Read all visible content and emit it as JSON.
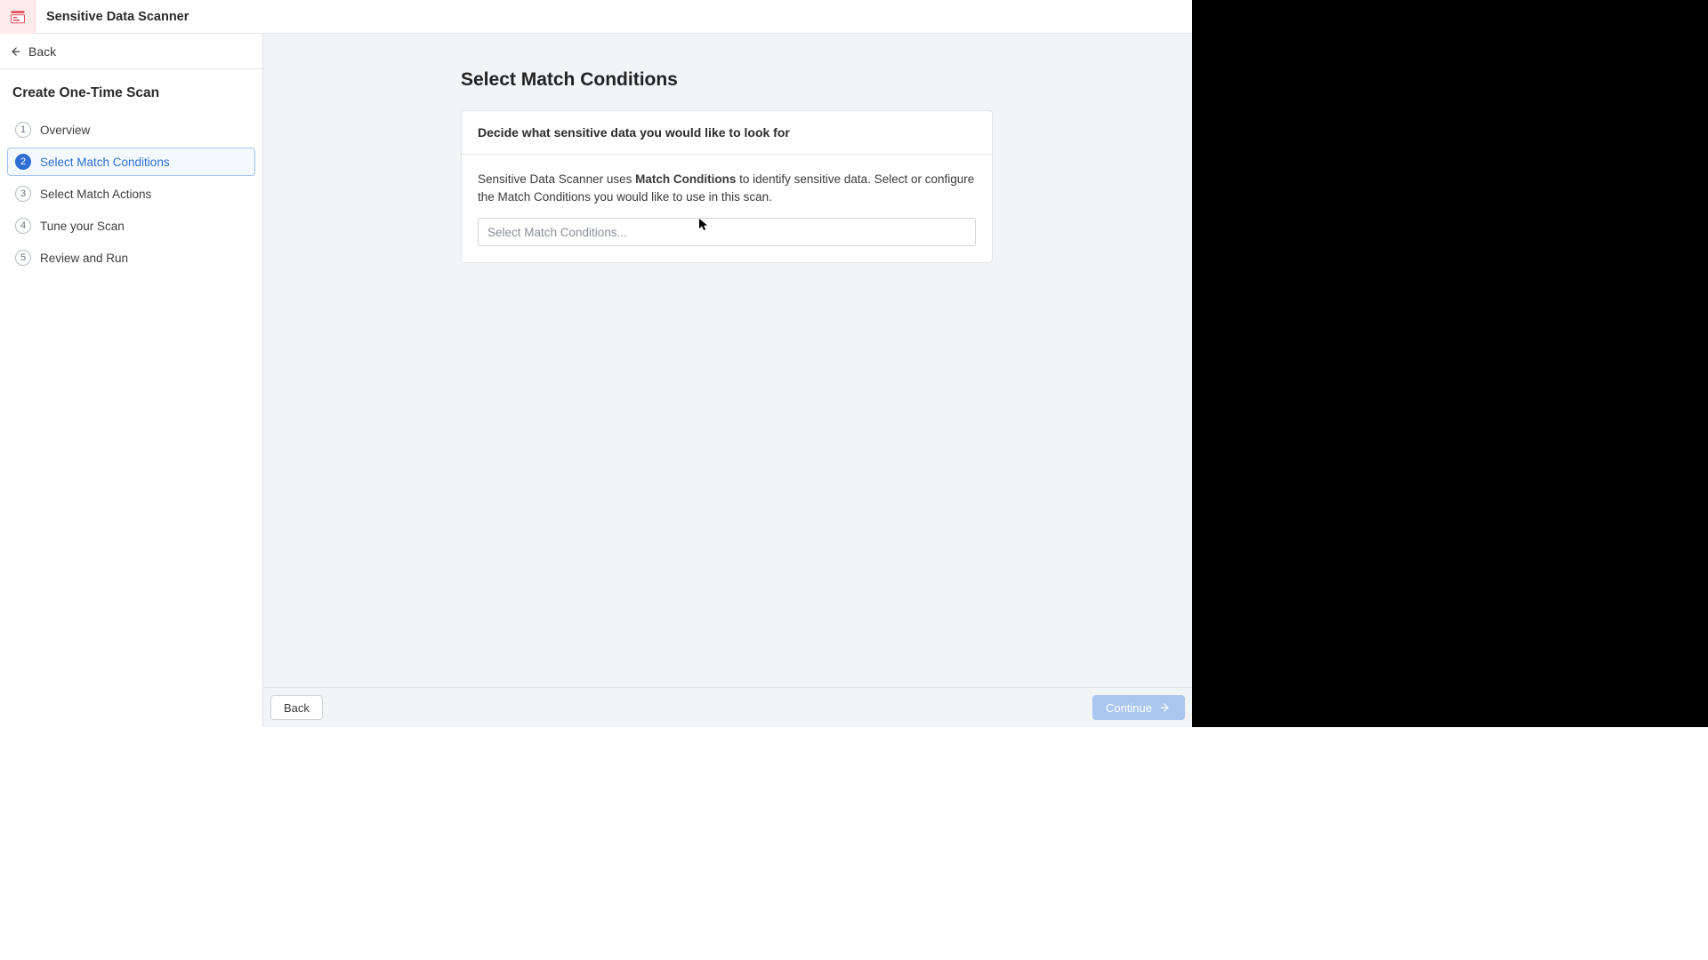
{
  "header": {
    "app_title": "Sensitive Data Scanner"
  },
  "sidebar": {
    "back_label": "Back",
    "heading": "Create One-Time Scan",
    "steps": [
      {
        "num": "1",
        "label": "Overview"
      },
      {
        "num": "2",
        "label": "Select Match Conditions"
      },
      {
        "num": "3",
        "label": "Select Match Actions"
      },
      {
        "num": "4",
        "label": "Tune your Scan"
      },
      {
        "num": "5",
        "label": "Review and Run"
      }
    ],
    "active_index": 1
  },
  "main": {
    "page_title": "Select Match Conditions",
    "card_header": "Decide what sensitive data you would like to look for",
    "desc_prefix": "Sensitive Data Scanner uses ",
    "desc_bold": "Match Conditions",
    "desc_suffix": " to identify sensitive data. Select or configure the Match Conditions you would like to use in this scan.",
    "select_placeholder": "Select Match Conditions..."
  },
  "footer": {
    "back_label": "Back",
    "continue_label": "Continue"
  }
}
